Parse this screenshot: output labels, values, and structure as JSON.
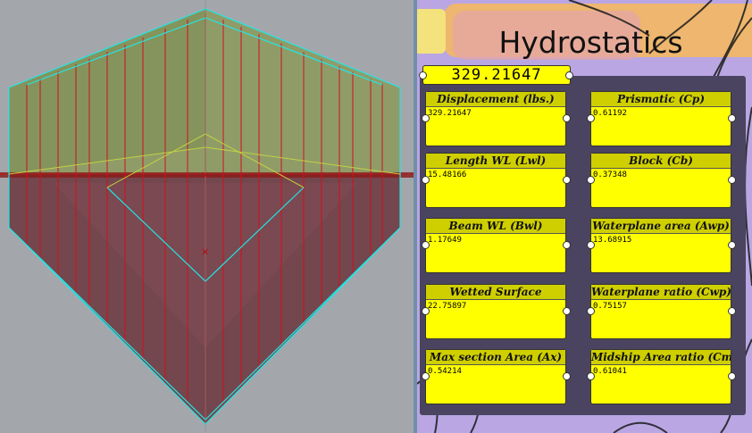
{
  "viewport": {
    "name": "3D hull viewport"
  },
  "canvas": {
    "group_title": "Hydrostatics",
    "main_value": "329.21647",
    "panels": [
      {
        "label": "Displacement (lbs.)",
        "value": "329.21647"
      },
      {
        "label": "Prismatic (Cp)",
        "value": "0.61192"
      },
      {
        "label": "Length WL (Lwl)",
        "value": "15.48166"
      },
      {
        "label": "Block (Cb)",
        "value": "0.37348"
      },
      {
        "label": "Beam WL (Bwl)",
        "value": "1.17649"
      },
      {
        "label": "Waterplane area (Awp)",
        "value": "13.68915"
      },
      {
        "label": "Wetted Surface",
        "value": "22.75897"
      },
      {
        "label": "Waterplane ratio (Cwp)",
        "value": "0.75157"
      },
      {
        "label": "Max section Area (Ax)",
        "value": "0.54214"
      },
      {
        "label": "Midship Area ratio (Cmc)",
        "value": "0.61041"
      }
    ]
  },
  "colors": {
    "panel_yellow": "#ffff00",
    "panel_header": "#cfcf00",
    "canvas_bg": "#b9a6e3",
    "viewport_bg": "#a3a7ac",
    "hull_above": "#8a9a5a",
    "hull_below": "#6b3a3e",
    "waterline": "#a01818",
    "station_lines": "#d01020",
    "outline_cyan": "#20e0e0"
  }
}
